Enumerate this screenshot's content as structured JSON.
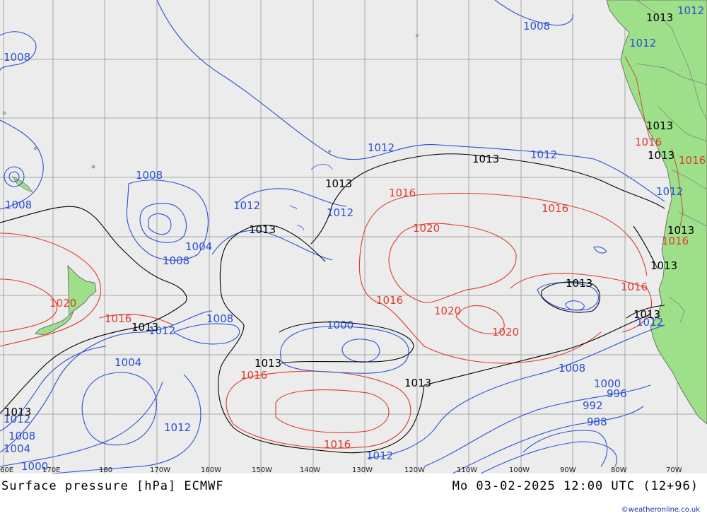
{
  "title": "Surface pressure [hPa] ECMWF",
  "valid_time": "Mo 03-02-2025 12:00 UTC (12+96)",
  "credit": "©weatheronline.co.uk",
  "longitude_labels": [
    "60E",
    "170E",
    "180",
    "170W",
    "160W",
    "150W",
    "140W",
    "130W",
    "120W",
    "110W",
    "100W",
    "90W",
    "80W",
    "70W"
  ],
  "colors": {
    "background_sea": "#ececec",
    "land": "#9ee08a",
    "grid": "#a8a8a8",
    "isobar_low": "#2a4fd6",
    "isobar_high": "#e03a2a",
    "isobar_1013": "#000000",
    "border": "#7a7a7a"
  },
  "isobar_labels": {
    "blue": [
      "1008",
      "1008",
      "1008",
      "1008",
      "1012",
      "1012",
      "1012",
      "1012",
      "1012",
      "1004",
      "1008",
      "1008",
      "1000",
      "1004",
      "1012",
      "1012",
      "1008",
      "1004",
      "1000",
      "1012",
      "1008",
      "1000",
      "996",
      "992",
      "988",
      "1012",
      "1012",
      "1012",
      "1012"
    ],
    "red": [
      "1016",
      "1016",
      "1020",
      "1016",
      "1016",
      "1020",
      "1020",
      "1016",
      "1020",
      "1016",
      "1016",
      "1016",
      "1016",
      "1016"
    ],
    "black": [
      "1013",
      "1013",
      "1013",
      "1013",
      "1013",
      "1013",
      "1013",
      "1013",
      "1013",
      "1013",
      "1013",
      "1013",
      "1013",
      "1013"
    ]
  }
}
